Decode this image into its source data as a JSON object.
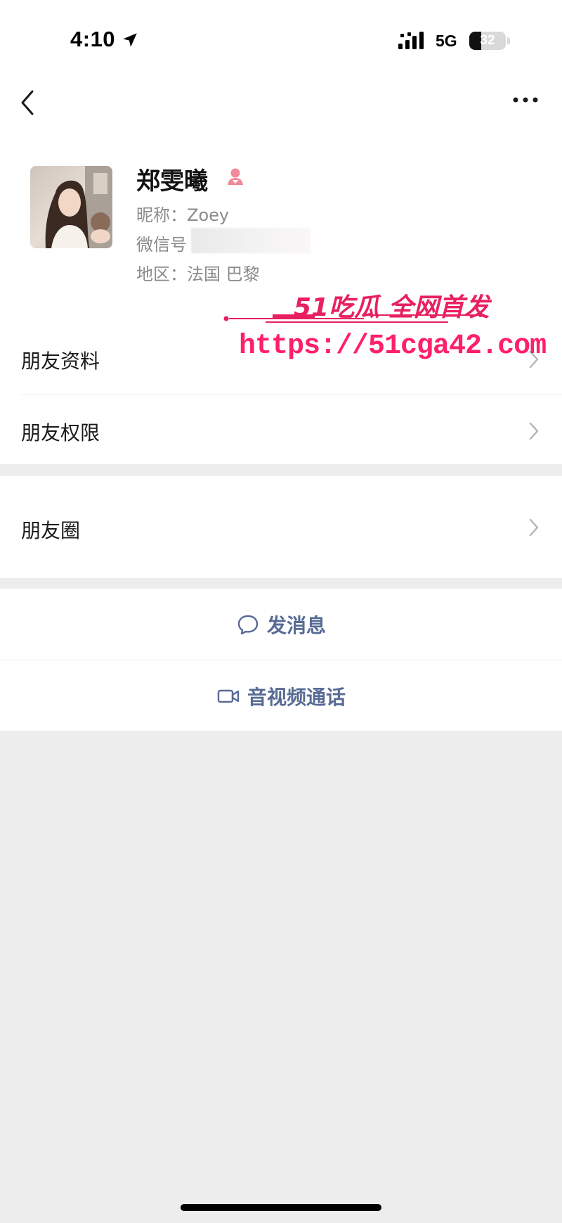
{
  "status_bar": {
    "time": "4:10",
    "network": "5G",
    "battery": "32",
    "battery_level": 0.32,
    "location_icon": "location-arrow-icon",
    "signal_icon": "cellular-signal-icon"
  },
  "nav": {
    "back_icon": "chevron-left-icon",
    "more_icon": "more-dots-icon"
  },
  "profile": {
    "name": "郑雯曦",
    "gender_icon": "female-icon",
    "nickname_line": "昵称：Zoey",
    "wechat_id_label": "微信号",
    "region_line": "地区：法国 巴黎"
  },
  "watermark": {
    "title": "51吃瓜 全网首发",
    "url": "https://51cga42.com",
    "color": "#e8205f"
  },
  "menu": {
    "friend_info": "朋友资料",
    "friend_permissions": "朋友权限",
    "moments": "朋友圈"
  },
  "actions": {
    "send_message": "发消息",
    "av_call": "音视频通话",
    "link_color": "#576b95"
  },
  "colors": {
    "background": "#ededed",
    "panel": "#ffffff"
  }
}
